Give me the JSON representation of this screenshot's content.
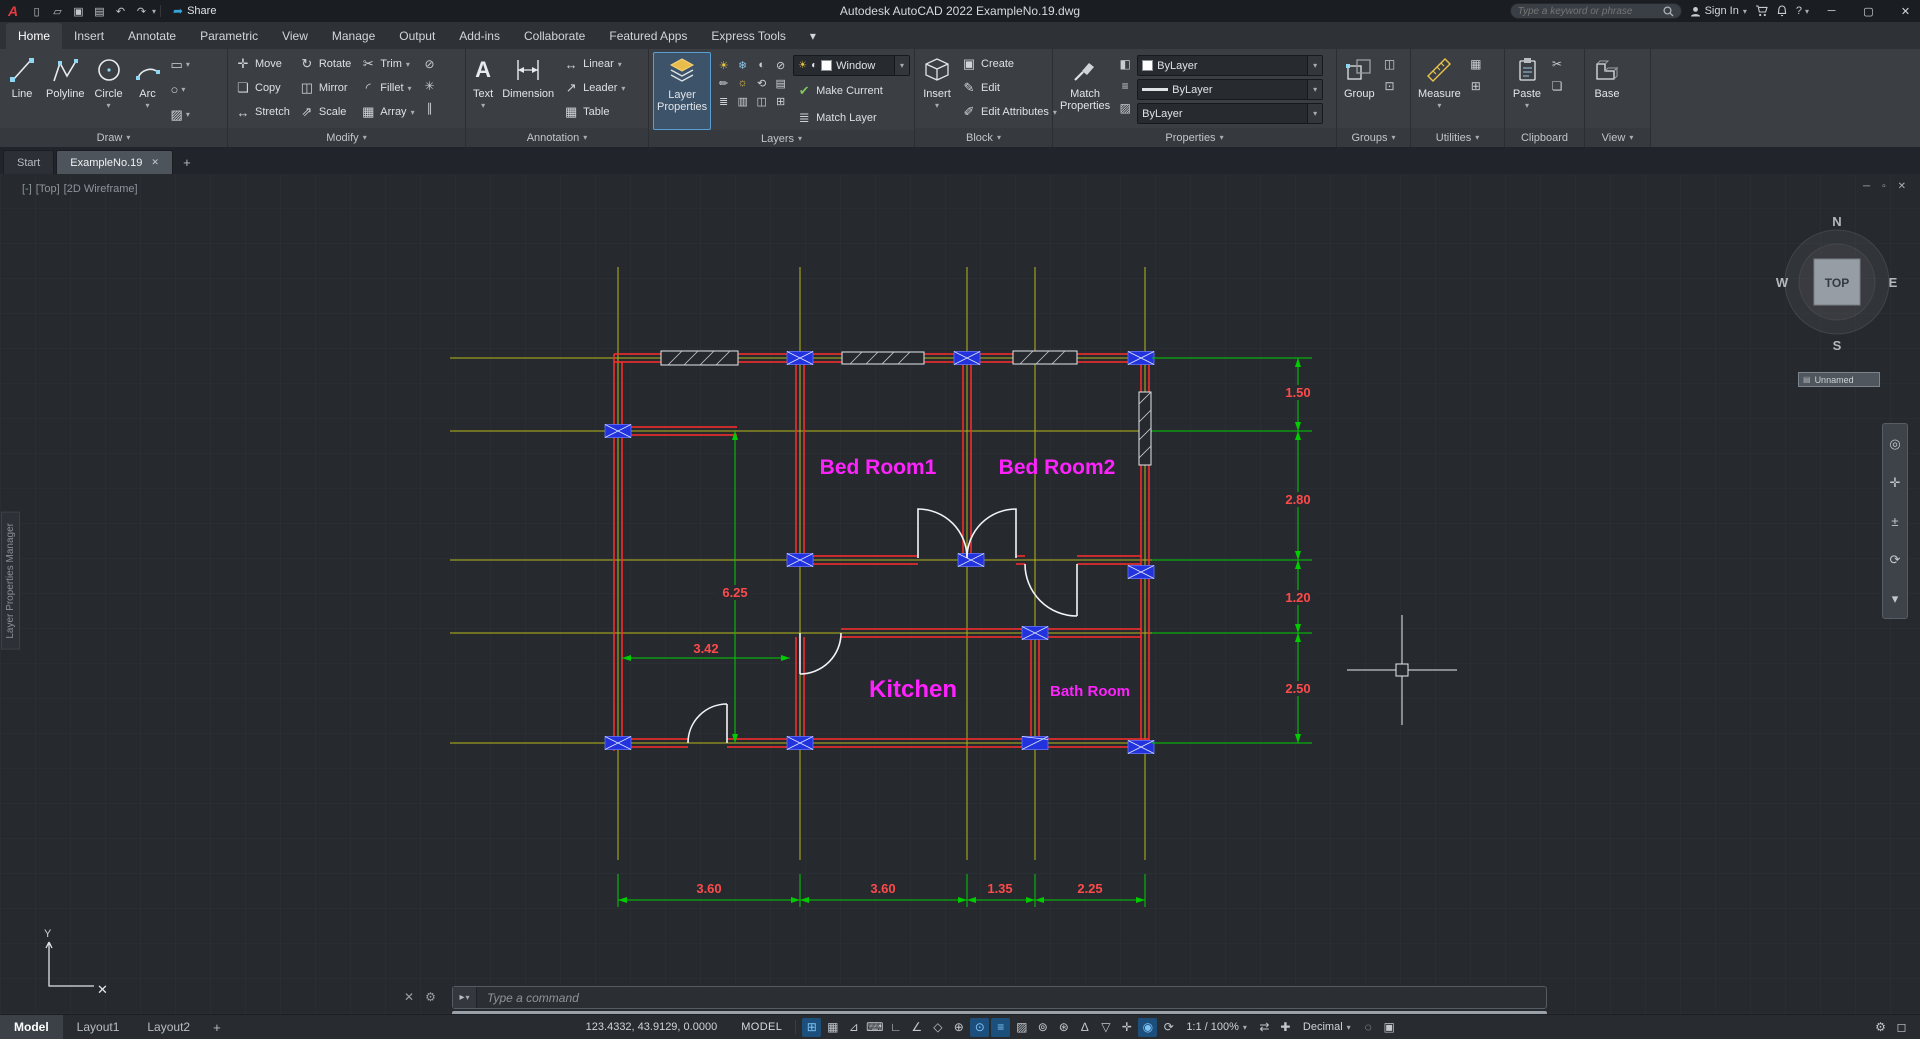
{
  "title_bar": {
    "logo": "A",
    "share_label": "Share",
    "app_title": "Autodesk AutoCAD 2022   ExampleNo.19.dwg",
    "search_placeholder": "Type a keyword or phrase",
    "sign_in_label": "Sign In",
    "qat": {
      "new": "▯",
      "open": "▱",
      "save": "▣",
      "plot": "▤",
      "undo": "↶",
      "redo": "↷",
      "share_icon": "➦"
    },
    "window": {
      "minimize": "─",
      "maximize": "▢",
      "close": "✕",
      "help": "?"
    }
  },
  "ui": {
    "dd": "▾"
  },
  "ribbon_tabs": [
    "Home",
    "Insert",
    "Annotate",
    "Parametric",
    "View",
    "Manage",
    "Output",
    "Add-ins",
    "Collaborate",
    "Featured Apps",
    "Express Tools"
  ],
  "panels": {
    "draw": {
      "label": "Draw",
      "line": "Line",
      "polyline": "Polyline",
      "circle": "Circle",
      "arc": "Arc",
      "rect_icon": "▭",
      "ellipse_icon": "○",
      "hatch_icon": "▨"
    },
    "modify": {
      "label": "Modify",
      "move": "Move",
      "rotate": "Rotate",
      "trim": "Trim",
      "copy": "Copy",
      "mirror": "Mirror",
      "fillet": "Fillet",
      "stretch": "Stretch",
      "scale": "Scale",
      "array": "Array",
      "move_icon": "✛",
      "rotate_icon": "↻",
      "trim_icon": "✂",
      "copy_icon": "❏",
      "mirror_icon": "◫",
      "fillet_icon": "◜",
      "stretch_icon": "↔",
      "scale_icon": "⇗",
      "array_icon": "▦",
      "erase_icon": "⊘",
      "explode_icon": "✳",
      "offset_icon": "∥"
    },
    "annotation": {
      "label": "Annotation",
      "text": "Text",
      "dimension": "Dimension",
      "linear": "Linear",
      "leader": "Leader",
      "table": "Table",
      "text_icon": "A",
      "linear_icon": "↔",
      "leader_icon": "↗",
      "table_icon": "▦"
    },
    "layers": {
      "label": "Layers",
      "lp1": "Layer",
      "lp2": "Properties",
      "dropdown_value": "Window",
      "make_current": "Make Current",
      "match_layer": "Match Layer",
      "make_current_icon": "✔",
      "match_layer_icon": "≣",
      "dd_sun": "☀",
      "dd_half": "◐",
      "tools": [
        "☀",
        "❄",
        "◐",
        "⊘",
        "✏",
        "☼",
        "⟲",
        "▤",
        "≣",
        "▥",
        "◫",
        "⊞"
      ]
    },
    "block": {
      "label": "Block",
      "insert": "Insert",
      "create": "Create",
      "edit": "Edit",
      "edit_attributes": "Edit Attributes",
      "create_icon": "▣",
      "edit_icon": "✎",
      "edit_attr_icon": "✐"
    },
    "properties": {
      "label": "Properties",
      "mp1": "Match",
      "mp2": "Properties",
      "color_value": "ByLayer",
      "lineweight_value": "ByLayer",
      "linetype_value": "ByLayer",
      "list_icon": "◧",
      "lines_icon": "≡",
      "transparency_icon": "▨"
    },
    "groups": {
      "label": "Groups",
      "group": "Group",
      "small1": "◫",
      "small2": "⊡"
    },
    "utilities": {
      "label": "Utilities",
      "measure": "Measure",
      "small1": "▦",
      "small2": "⊞"
    },
    "clipboard": {
      "label": "Clipboard",
      "paste": "Paste",
      "cut_icon": "✂",
      "copy_icon": "❏"
    },
    "view": {
      "label": "View",
      "base": "Base"
    }
  },
  "file_tabs": {
    "start": "Start",
    "drawing": "ExampleNo.19",
    "close": "✕",
    "new": "+"
  },
  "viewport": {
    "controls_minus": "[-]",
    "controls_top": "[Top]",
    "controls_style": "[2D Wireframe]",
    "win_min": "─",
    "win_restore": "▫",
    "win_close": "✕",
    "viewcube": {
      "n": "N",
      "e": "E",
      "s": "S",
      "w": "W",
      "top": "TOP"
    },
    "unnamed": "Unnamed",
    "unnamed_icon": "▤",
    "palette_tab": "Layer Properties Manager",
    "ucs_y": "Y",
    "ucs_x_marker": "✕",
    "nav": [
      "◎",
      "✛",
      "±",
      "⟳",
      "▾"
    ]
  },
  "drawing": {
    "rooms": {
      "bedroom1": "Bed Room1",
      "bedroom2": "Bed Room2",
      "kitchen": "Kitchen",
      "bathroom": "Bath Room"
    },
    "dims": {
      "right1": "1.50",
      "right2": "2.80",
      "right3": "1.20",
      "right4": "2.50",
      "bottom1": "3.60",
      "bottom2": "3.60",
      "bottom3": "1.35",
      "bottom4": "2.25",
      "inner_v": "6.25",
      "inner_h": "3.42"
    },
    "colors": {
      "wall": "#ff2d2d",
      "grid": "#b5b51a",
      "column": "#2233dd",
      "label": "#ff22ff",
      "dim_line": "#00cc00",
      "dim_text": "#ff4a4a",
      "door": "#f2f4f6"
    }
  },
  "command_line": {
    "prompt": "Type a command",
    "close_icon": "✕",
    "customize_icon": "⚙",
    "prompt_icon": "▸"
  },
  "bottom_bar": {
    "model_tab": "Model",
    "layout1_tab": "Layout1",
    "layout2_tab": "Layout2",
    "new_layout": "+",
    "coordinates": "123.4332, 43.9129, 0.0000",
    "model_badge": "MODEL",
    "scale": "1:1 / 100%",
    "units": "Decimal"
  },
  "status_icons": [
    {
      "name": "grid-display",
      "glyph": "⊞",
      "active": true
    },
    {
      "name": "snap-mode",
      "glyph": "▦",
      "active": false
    },
    {
      "name": "infer-constraints",
      "glyph": "⊿",
      "active": false
    },
    {
      "name": "dynamic-input",
      "glyph": "⌨",
      "active": false
    },
    {
      "name": "ortho-mode",
      "glyph": "∟",
      "active": false
    },
    {
      "name": "polar-tracking",
      "glyph": "∠",
      "active": false
    },
    {
      "name": "isometric-drafting",
      "glyph": "◇",
      "active": false
    },
    {
      "name": "object-snap-tracking",
      "glyph": "⊕",
      "active": false
    },
    {
      "name": "object-snap",
      "glyph": "⊙",
      "active": true
    },
    {
      "name": "lineweight",
      "glyph": "≡",
      "active": true
    },
    {
      "name": "transparency",
      "glyph": "▨",
      "active": false
    },
    {
      "name": "selection-cycling",
      "glyph": "⊚",
      "active": false
    },
    {
      "name": "object-snap-3d",
      "glyph": "⊛",
      "active": false
    },
    {
      "name": "dynamic-ucs",
      "glyph": "∆",
      "active": false
    },
    {
      "name": "selection-filtering",
      "glyph": "▽",
      "active": false
    },
    {
      "name": "gizmo",
      "glyph": "✛",
      "active": false
    },
    {
      "name": "annotation-visibility",
      "glyph": "◉",
      "active": true
    },
    {
      "name": "autoscale",
      "glyph": "⟳",
      "active": false
    },
    {
      "name": "workspace-switching",
      "glyph": "⇄",
      "active": false
    },
    {
      "name": "annotation-monitor",
      "glyph": "✚",
      "active": false
    },
    {
      "name": "isolate-objects",
      "glyph": "◌",
      "active": false
    },
    {
      "name": "graphics-performance",
      "glyph": "▣",
      "active": false
    },
    {
      "name": "customization",
      "glyph": "⚙",
      "active": false
    },
    {
      "name": "clean-screen",
      "glyph": "◻",
      "active": false
    }
  ]
}
